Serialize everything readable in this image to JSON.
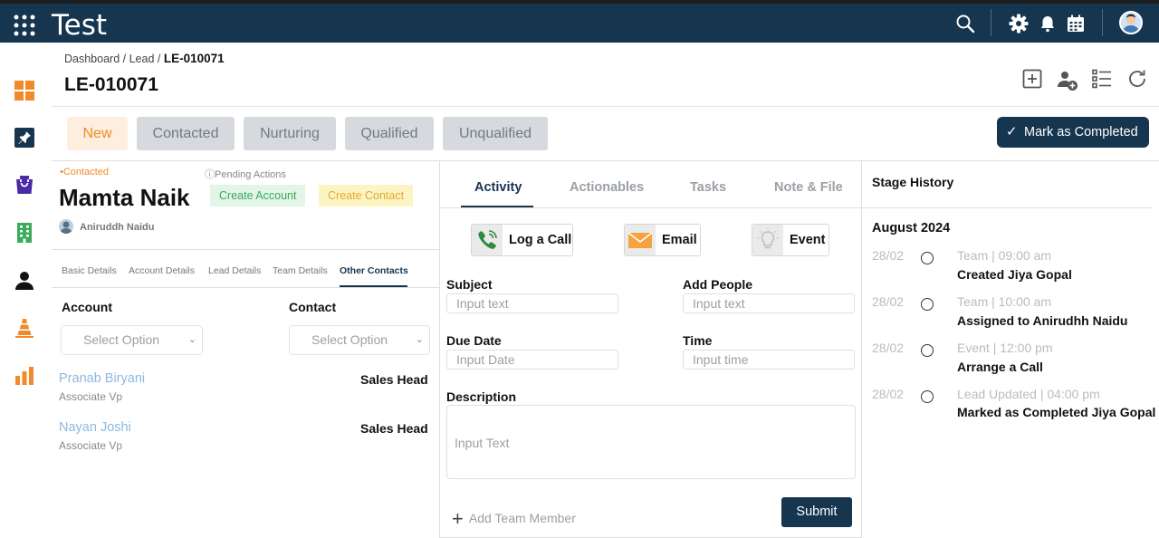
{
  "app": {
    "title": "Test"
  },
  "breadcrumb": {
    "items": [
      "Dashboard",
      "Lead"
    ],
    "separator": "/",
    "current": "LE-010071"
  },
  "page_title": "LE-010071",
  "stages": [
    {
      "label": "New",
      "active": true
    },
    {
      "label": "Contacted",
      "active": false
    },
    {
      "label": "Nurturing",
      "active": false
    },
    {
      "label": "Qualified",
      "active": false
    },
    {
      "label": "Unqualified",
      "active": false
    }
  ],
  "mark_completed_label": "Mark as Completed",
  "lead": {
    "status": "•Contacted",
    "pending_actions": "ⓘPending Actions",
    "name": "Mamta Naik",
    "owner": "Aniruddh Naidu",
    "create_account": "Create Account",
    "create_contact": "Create Contact"
  },
  "detail_tabs": [
    "Basic Details",
    "Account Details",
    "Lead Details",
    "Team Details",
    "Other Contacts"
  ],
  "detail_tabs_active": "Other Contacts",
  "other_contacts": {
    "account_label": "Account",
    "contact_label": "Contact",
    "account_select": "Select Option",
    "contact_select": "Select Option",
    "contacts": [
      {
        "name": "Pranab Biryani",
        "role": "Associate Vp",
        "title": "Sales Head"
      },
      {
        "name": "Nayan Joshi",
        "role": "Associate Vp",
        "title": "Sales Head"
      }
    ]
  },
  "activity_tabs": [
    "Activity",
    "Actionables",
    "Tasks",
    "Note & File"
  ],
  "activity_tabs_active": "Activity",
  "activity_buttons": {
    "call": "Log a Call",
    "email": "Email",
    "event": "Event"
  },
  "form": {
    "subject_label": "Subject",
    "subject_placeholder": "Input text",
    "people_label": "Add People",
    "people_placeholder": "Input text",
    "due_label": "Due Date",
    "due_placeholder": "Input Date",
    "time_label": "Time",
    "time_placeholder": "Input time",
    "description_label": "Description",
    "description_placeholder": "Input Text",
    "add_member": "Add Team Member",
    "submit": "Submit"
  },
  "stage_history": {
    "title": "Stage History",
    "month": "August 2024",
    "entries": [
      {
        "date": "28/02",
        "meta": "Team | 09:00 am",
        "text": "Created Jiya Gopal"
      },
      {
        "date": "28/02",
        "meta": "Team | 10:00 am",
        "text": "Assigned to Anirudhh Naidu"
      },
      {
        "date": "28/02",
        "meta": "Event | 12:00 pm",
        "text": "Arrange a Call"
      },
      {
        "date": "28/02",
        "meta": "Lead Updated | 04:00 pm",
        "text": "Marked as Completed Jiya Gopal"
      }
    ]
  },
  "colors": {
    "navy": "#16354f",
    "orange": "#f08a2c",
    "link_blue": "#8cb9df",
    "green_pill": "#3aaa5b",
    "yellow_pill": "#e2a92b"
  },
  "icons": {
    "topbar": [
      "apps-grid-icon",
      "search-icon",
      "gear-icon",
      "bell-icon",
      "calendar-icon",
      "user-avatar"
    ],
    "header": [
      "add-box-icon",
      "add-user-icon",
      "checklist-icon",
      "refresh-icon"
    ],
    "sidebar": [
      "dashboard-icon",
      "pin-icon",
      "bag-icon",
      "building-icon",
      "person-icon",
      "funnel-icon",
      "bar-chart-icon"
    ]
  }
}
